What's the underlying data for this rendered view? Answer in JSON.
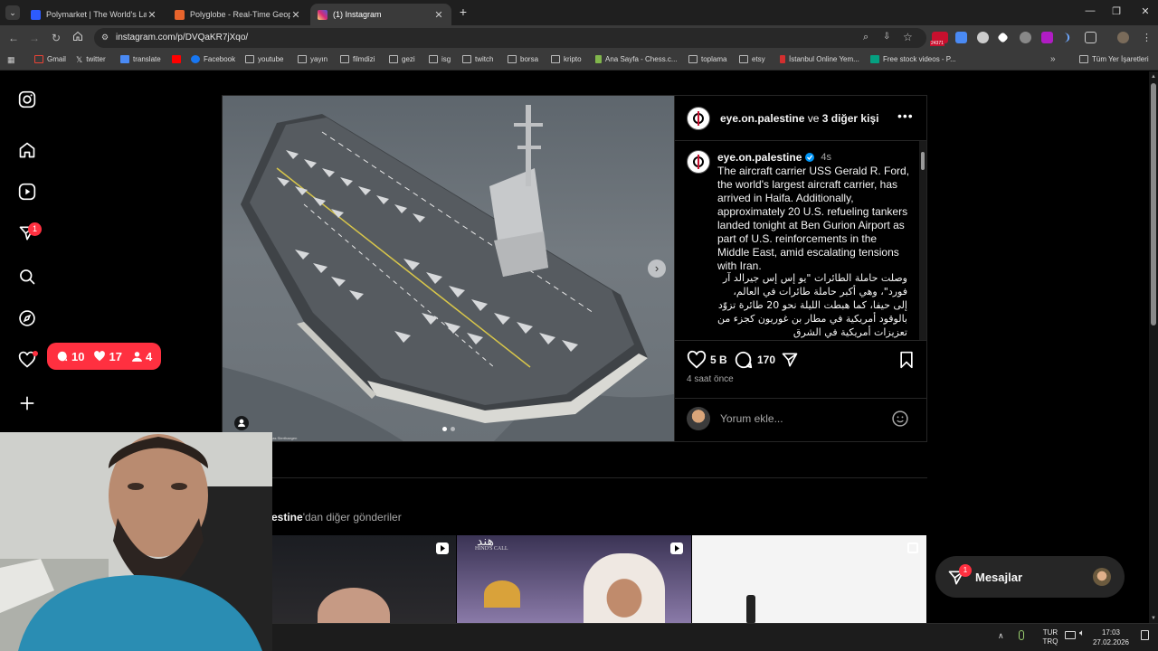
{
  "browser": {
    "tabs": [
      {
        "title": "Polymarket | The World's Large",
        "active": false,
        "favicon_color": "#2d5bff"
      },
      {
        "title": "Polyglobe - Real-Time Geopolit",
        "active": false,
        "favicon_color": "#e8642c"
      },
      {
        "title": "(1) Instagram",
        "active": true,
        "favicon_color": "#d6249f"
      }
    ],
    "url": "instagram.com/p/DVQaKR7jXqo/",
    "extension_badge": "24371",
    "bookmarks": [
      {
        "label": "Gmail",
        "icon": "gmail-icon"
      },
      {
        "label": "twitter",
        "icon": "x-icon"
      },
      {
        "label": "translate",
        "icon": "translate-icon"
      },
      {
        "label": "",
        "icon": "youtube-icon"
      },
      {
        "label": "Facebook",
        "icon": "facebook-icon"
      },
      {
        "label": "youtube",
        "icon": "folder-icon"
      },
      {
        "label": "yayın",
        "icon": "folder-icon"
      },
      {
        "label": "filmdizi",
        "icon": "folder-icon"
      },
      {
        "label": "gezi",
        "icon": "folder-icon"
      },
      {
        "label": "isg",
        "icon": "folder-icon"
      },
      {
        "label": "twitch",
        "icon": "folder-icon"
      },
      {
        "label": "borsa",
        "icon": "folder-icon"
      },
      {
        "label": "kripto",
        "icon": "folder-icon"
      },
      {
        "label": "Ana Sayfa - Chess.c...",
        "icon": "chess-icon"
      },
      {
        "label": "toplama",
        "icon": "folder-icon"
      },
      {
        "label": "etsy",
        "icon": "folder-icon"
      },
      {
        "label": "İstanbul Online Yem...",
        "icon": "site-icon"
      },
      {
        "label": "Free stock videos - P...",
        "icon": "site-icon"
      }
    ],
    "all_bookmarks": "Tüm Yer İşaretleri"
  },
  "sidebar": {
    "badge_count": "1",
    "notifications": {
      "comments": "10",
      "likes": "17",
      "follows": "4"
    }
  },
  "post": {
    "header_user": "eye.on.palestine",
    "header_connector": "ve",
    "header_others": "3 diğer kişi",
    "caption_user": "eye.on.palestine",
    "caption_time": "4s",
    "caption_en": "The aircraft carrier USS Gerald R. Ford, the world's largest aircraft carrier, has arrived in Haifa. Additionally, approximately 20 U.S. refueling tankers landed tonight at Ben Gurion Airport as part of U.S. reinforcements in the Middle East, amid escalating tensions with Iran.",
    "caption_ar": "وصلت حاملة الطائرات \"يو إس إس جيرالد آر فورد\"، وهي أكبر حاملة طائرات في العالم، إلى حيفا، كما هبطت الليلة نحو 20 طائرة تزوّد بالوقود أمريكية في مطار بن غوريون كجزء من تعزيزات أمريكية في الشرق",
    "likes": "5 B",
    "comments": "170",
    "time_ago": "4 saat önce",
    "comment_placeholder": "Yorum ekle...",
    "photo_credit": "nas Sterthaegen"
  },
  "more": {
    "title_user": "estine",
    "title_rest": "'dan diğer gönderiler",
    "thumb2_label": "هند",
    "thumb2_sub": "HIND'S CALL"
  },
  "messages": {
    "label": "Mesajlar",
    "badge": "1"
  },
  "taskbar": {
    "lang_top": "TUR",
    "lang_bottom": "TRQ",
    "time": "17:03",
    "date": "27.02.2026"
  }
}
